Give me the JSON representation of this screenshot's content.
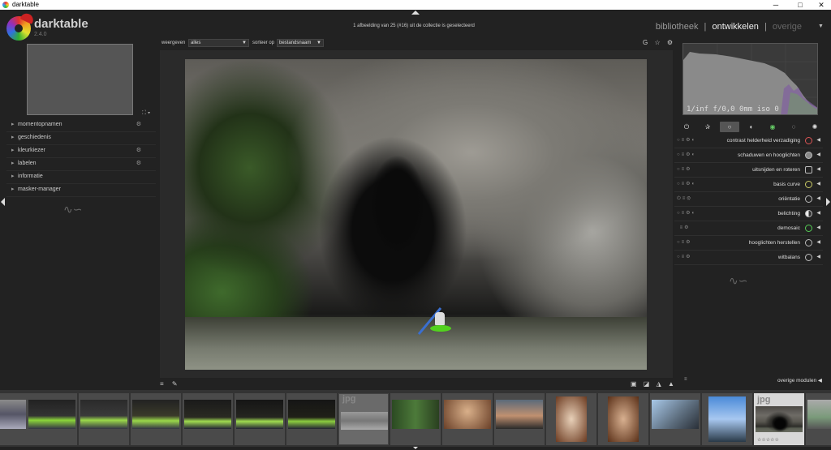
{
  "window": {
    "title": "darktable",
    "minimize": "─",
    "maximize": "□",
    "close": "✕"
  },
  "app": {
    "name": "darktable",
    "version": "2.4.0"
  },
  "header": {
    "status": "1 afbeelding van 25 (#16) uit de collectie is geselecteerd"
  },
  "views": {
    "library": "bibliotheek",
    "darkroom": "ontwikkelen",
    "other": "overige",
    "separator": "|"
  },
  "filter": {
    "show_label": "weergeven",
    "show_value": "alles",
    "sort_label": "sorteer op",
    "sort_value": "bestandsnaam"
  },
  "left_panel": {
    "items": [
      {
        "label": "momentopnamen",
        "has_gear": true
      },
      {
        "label": "geschiedenis",
        "has_gear": false
      },
      {
        "label": "kleurkiezer",
        "has_gear": true
      },
      {
        "label": "labelen",
        "has_gear": true
      },
      {
        "label": "informatie",
        "has_gear": false
      },
      {
        "label": "masker-manager",
        "has_gear": false
      }
    ]
  },
  "histogram": {
    "info": "1/inf f/0,0 0mm iso 0"
  },
  "module_groups": [
    "power-icon",
    "star-icon",
    "circle-icon",
    "contrast-icon",
    "color-icon",
    "correct-icon",
    "effect-icon"
  ],
  "modules": [
    {
      "name": "contrast helderheid verzadiging",
      "icon": "palette-icon"
    },
    {
      "name": "schaduwen en hooglichten",
      "icon": "shadows-icon"
    },
    {
      "name": "uitsnijden en roteren",
      "icon": "crop-icon"
    },
    {
      "name": "basis curve",
      "icon": "curve-icon"
    },
    {
      "name": "oriëntatie",
      "icon": "flip-icon"
    },
    {
      "name": "belichting",
      "icon": "exposure-icon"
    },
    {
      "name": "demosaic",
      "icon": "demosaic-icon"
    },
    {
      "name": "hooglichten herstellen",
      "icon": "highlights-icon"
    },
    {
      "name": "witbalans",
      "icon": "whitebalance-icon"
    }
  ],
  "more_modules": "overige modulen",
  "filmstrip": {
    "ext_label": "jpg",
    "stars": "☆☆☆☆☆"
  },
  "colors": {
    "accent": "#52d21e",
    "panel": "#222222",
    "filmstrip": "#333333"
  }
}
